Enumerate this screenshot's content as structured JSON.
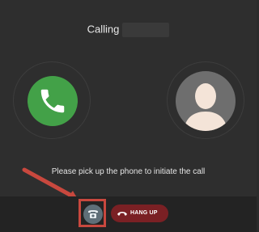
{
  "call": {
    "status_label": "Calling",
    "callee_name": ""
  },
  "message": "Please pick up the phone to initiate the call",
  "controls": {
    "hangup_label": "HANG UP",
    "hangup_icon": "telephone-icon"
  },
  "icons": {
    "phone": "phone-icon",
    "avatar": "user-avatar-icon",
    "annotation": "red-arrow-annotation"
  },
  "colors": {
    "background": "#2e2e2e",
    "bar": "#232323",
    "phone_green": "#43a148",
    "hangup_red": "#7a2024",
    "annotation_red": "#c8483e"
  }
}
